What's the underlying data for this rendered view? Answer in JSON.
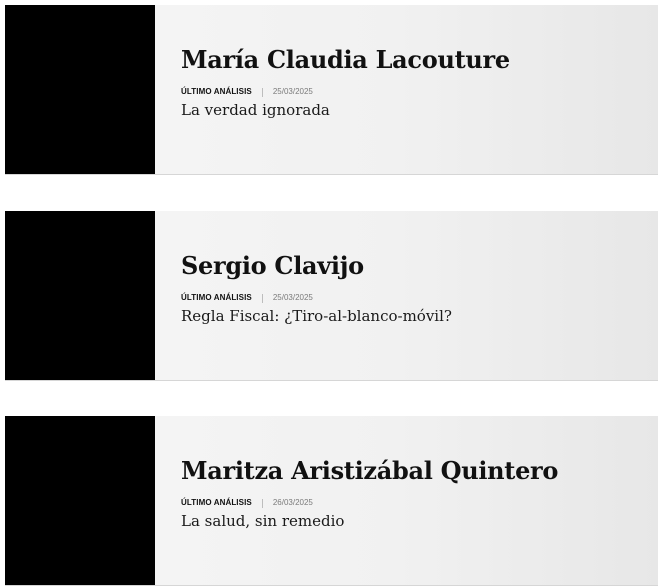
{
  "columnists": [
    {
      "name": "María Claudia Lacouture",
      "label": "ÚLTIMO ANÁLISIS",
      "date": "25/03/2025",
      "headline": "La verdad ignorada"
    },
    {
      "name": "Sergio Clavijo",
      "label": "ÚLTIMO ANÁLISIS",
      "date": "25/03/2025",
      "headline": "Regla Fiscal: ¿Tiro-al-blanco-móvil?"
    },
    {
      "name": "Maritza Aristizábal Quintero",
      "label": "ÚLTIMO ANÁLISIS",
      "date": "26/03/2025",
      "headline": "La salud, sin remedio"
    }
  ]
}
